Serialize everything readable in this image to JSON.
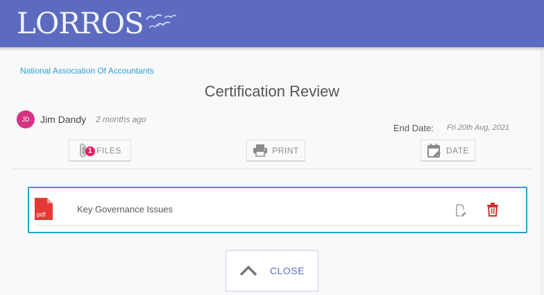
{
  "brand": {
    "logo_text": "LORROS",
    "header_color": "#5c6bc0"
  },
  "organization": "National Association Of Accountants",
  "document": {
    "title": "Certification Review",
    "author_initials": "JD",
    "author_name": "Jim Dandy",
    "posted_relative": "2 months ago",
    "end_date_label": "End Date:",
    "end_date_value": "Fri 20th Aug, 2021"
  },
  "toolbar": {
    "files_label": "FILES",
    "files_count": "1",
    "print_label": "PRINT",
    "date_label": "DATE"
  },
  "files": [
    {
      "name": "Key Governance Issues",
      "type_label": "pdf"
    }
  ],
  "actions": {
    "close_label": "CLOSE"
  },
  "icons": {
    "files": "paperclip-icon",
    "print": "printer-icon",
    "date": "calendar-edit-icon",
    "file_type": "pdf-file-icon",
    "edit": "edit-file-icon",
    "delete": "trash-icon",
    "close": "chevron-up-icon"
  },
  "colors": {
    "accent": "#2a9fd6",
    "badge": "#e91e63",
    "avatar": "#d63384",
    "pdf": "#e53935",
    "delete": "#d32f2f"
  }
}
